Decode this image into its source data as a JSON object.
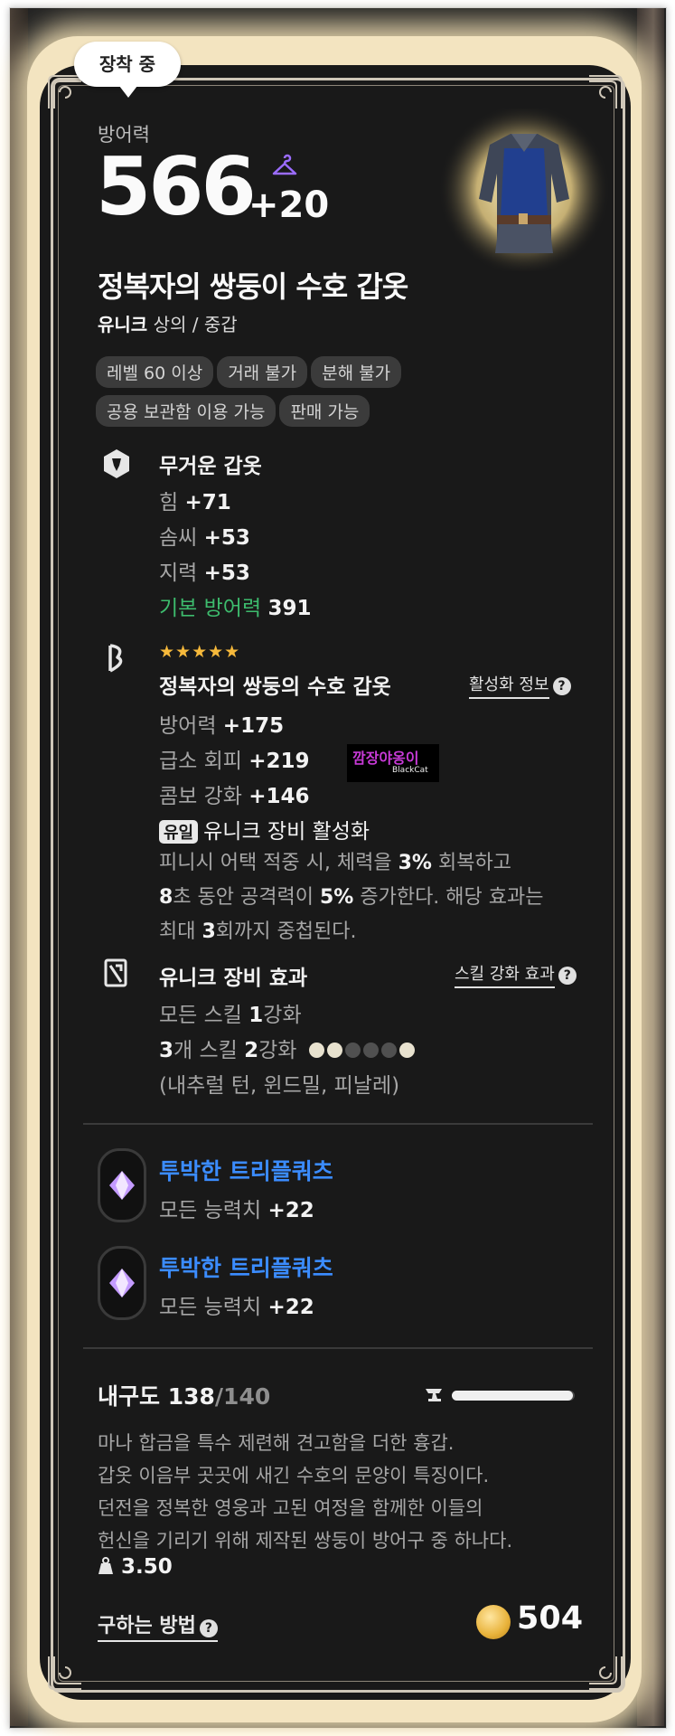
{
  "badge": "장착 중",
  "stat": {
    "label": "방어력",
    "value": "566",
    "bonus": "+20"
  },
  "item": {
    "name": "정복자의 쌍둥이 수호 갑옷",
    "grade": "유니크",
    "category": "상의 / 중갑",
    "image": "armor-image"
  },
  "tags": [
    "레벨 60 이상",
    "거래 불가",
    "분해 불가",
    "공용 보관함 이용 가능",
    "판매 가능"
  ],
  "base_section": {
    "title": "무거운 갑옷",
    "lines": [
      {
        "label": "힘",
        "value": "+71"
      },
      {
        "label": "솜씨",
        "value": "+53"
      },
      {
        "label": "지력",
        "value": "+53"
      }
    ],
    "base_def_label": "기본 방어력",
    "base_def_value": "391"
  },
  "set_section": {
    "stars": "★★★★★",
    "title": "정복자의 쌍둥의 수호 갑옷",
    "info_link": "활성화 정보",
    "lines": [
      {
        "label": "방어력",
        "value": "+175"
      },
      {
        "label": "급소 회피",
        "value": "+219"
      },
      {
        "label": "콤보 강화",
        "value": "+146"
      }
    ],
    "unique_tag": "유일",
    "unique_title": "유니크 장비 활성화",
    "desc": {
      "p1": "피니시 어택 적중 시, 체력을",
      "v1": "3%",
      "p2": "회복하고",
      "v2": "8",
      "p3": "초 동안 공격력이",
      "v3": "5%",
      "p4": "증가한다. 해당 효과는",
      "p5": "최대",
      "v4": "3",
      "p6": "회까지 중첩된다."
    }
  },
  "unique_section": {
    "title": "유니크 장비 효과",
    "link": "스킬 강화 효과",
    "line1_a": "모든 스킬",
    "line1_b": "1",
    "line1_c": "강화",
    "line2_a": "3",
    "line2_b": "개 스킬",
    "line2_c": "2",
    "line2_d": "강화",
    "dots": [
      "#e8e2cf",
      "#e8e2cf",
      "#505050",
      "#505050",
      "#505050",
      "#e8e2cf"
    ],
    "skills": "(내추럴 턴, 윈드밀, 피날레)"
  },
  "gems": [
    {
      "name": "투박한 트리플쿼츠",
      "stat_label": "모든 능력치",
      "stat_value": "+22"
    },
    {
      "name": "투박한 트리플쿼츠",
      "stat_label": "모든 능력치",
      "stat_value": "+22"
    }
  ],
  "durability": {
    "label": "내구도",
    "current": "138",
    "max": "/140",
    "fraction": 0.986
  },
  "lore": [
    "마나 합금을 특수 제련해 견고함을 더한 흉갑.",
    "갑옷 이음부 곳곳에 새긴 수호의 문양이 특징이다.",
    "던전을 정복한 영웅과 고된 여정을 함께한 이들의",
    "헌신을 기리기 위해 제작된 쌍둥이 방어구 중 하나다."
  ],
  "weight": "3.50",
  "how_to_get": "구하는 방법",
  "price": "504",
  "watermark": {
    "line1": "깜장야옹이",
    "line2": "BlackCat"
  },
  "colors": {
    "accent_blue": "#3b8cff",
    "green": "#3dbb6d",
    "star": "#f6b93b",
    "hanger": "#9b6cff"
  }
}
